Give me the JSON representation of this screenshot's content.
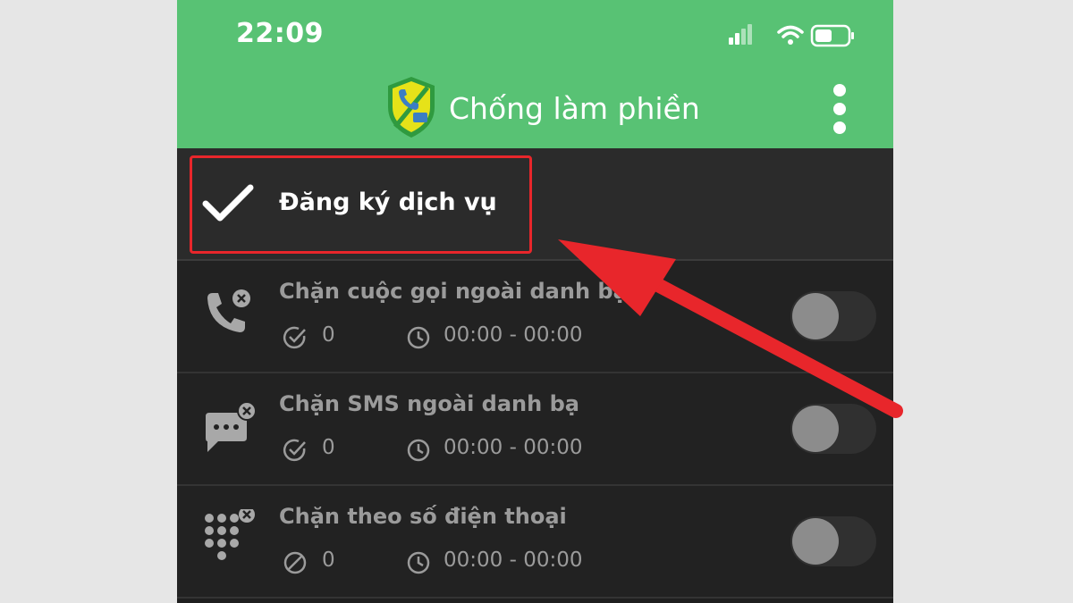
{
  "status_bar": {
    "time": "22:09",
    "icons": [
      "signal-icon",
      "wifi-icon",
      "battery-icon"
    ]
  },
  "app_bar": {
    "title": "Chống làm phiền",
    "logo_icon": "shield-logo-icon",
    "menu_icon": "more-vert-icon"
  },
  "register": {
    "label": "Đăng ký dịch vụ",
    "icon": "check-icon",
    "highlight_color": "#e8262b"
  },
  "features": [
    {
      "title": "Chặn cuộc gọi ngoài danh bạ",
      "icon": "phone-block-icon",
      "count_icon": "check-circle-icon",
      "count": "0",
      "time_range": "00:00 - 00:00",
      "enabled": false
    },
    {
      "title": "Chặn SMS ngoài danh bạ",
      "icon": "sms-block-icon",
      "count_icon": "check-circle-icon",
      "count": "0",
      "time_range": "00:00 - 00:00",
      "enabled": false
    },
    {
      "title": "Chặn theo số điện thoại",
      "icon": "dialpad-block-icon",
      "count_icon": "block-circle-icon",
      "count": "0",
      "time_range": "00:00 - 00:00",
      "enabled": false
    }
  ],
  "colors": {
    "brand_green": "#58c274",
    "background": "#222222",
    "annotation_red": "#e8262b"
  }
}
